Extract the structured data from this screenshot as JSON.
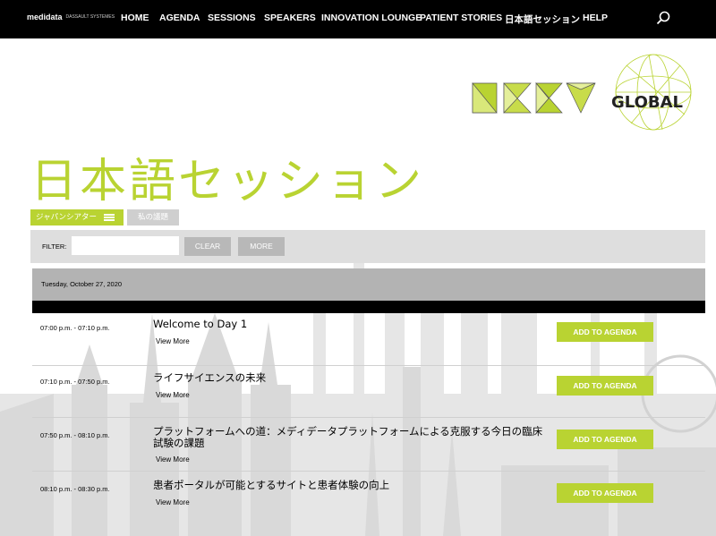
{
  "brand": {
    "name": "medidata",
    "sub": "DASSAULT SYSTEMES"
  },
  "nav": [
    "HOME",
    "AGENDA",
    "SESSIONS",
    "SPEAKERS",
    "INNOVATION LOUNGE",
    "PATIENT STORIES",
    "日本語セッション",
    "HELP"
  ],
  "logo": {
    "text": "GLOBAL"
  },
  "page_title": "日本語セッション",
  "tabs": {
    "primary": "ジャパンシアター",
    "secondary": "私の議題"
  },
  "filter": {
    "label": "FILTER:",
    "value": "",
    "clear": "CLEAR",
    "more": "MORE"
  },
  "date": "Tuesday, October 27, 2020",
  "sessions": [
    {
      "time": "07:00 p.m. - 07:10 p.m.",
      "title": "Welcome to Day 1",
      "more": "View More",
      "add": "ADD TO AGENDA"
    },
    {
      "time": "07:10 p.m. - 07:50 p.m.",
      "title": "ライフサイエンスの未来",
      "more": "View More",
      "add": "ADD TO AGENDA"
    },
    {
      "time": "07:50 p.m. - 08:10 p.m.",
      "title": "プラットフォームへの道：メディデータプラットフォームによる克服する今日の臨床試験の課題",
      "more": "View More",
      "add": "ADD TO AGENDA"
    },
    {
      "time": "08:10 p.m. - 08:30 p.m.",
      "title": "患者ポータルが可能とするサイトと患者体験の向上",
      "more": "View More",
      "add": "ADD TO AGENDA"
    }
  ],
  "colors": {
    "accent": "#b9d332",
    "nav_bg": "#000000",
    "gray": "#b8b8b8"
  }
}
